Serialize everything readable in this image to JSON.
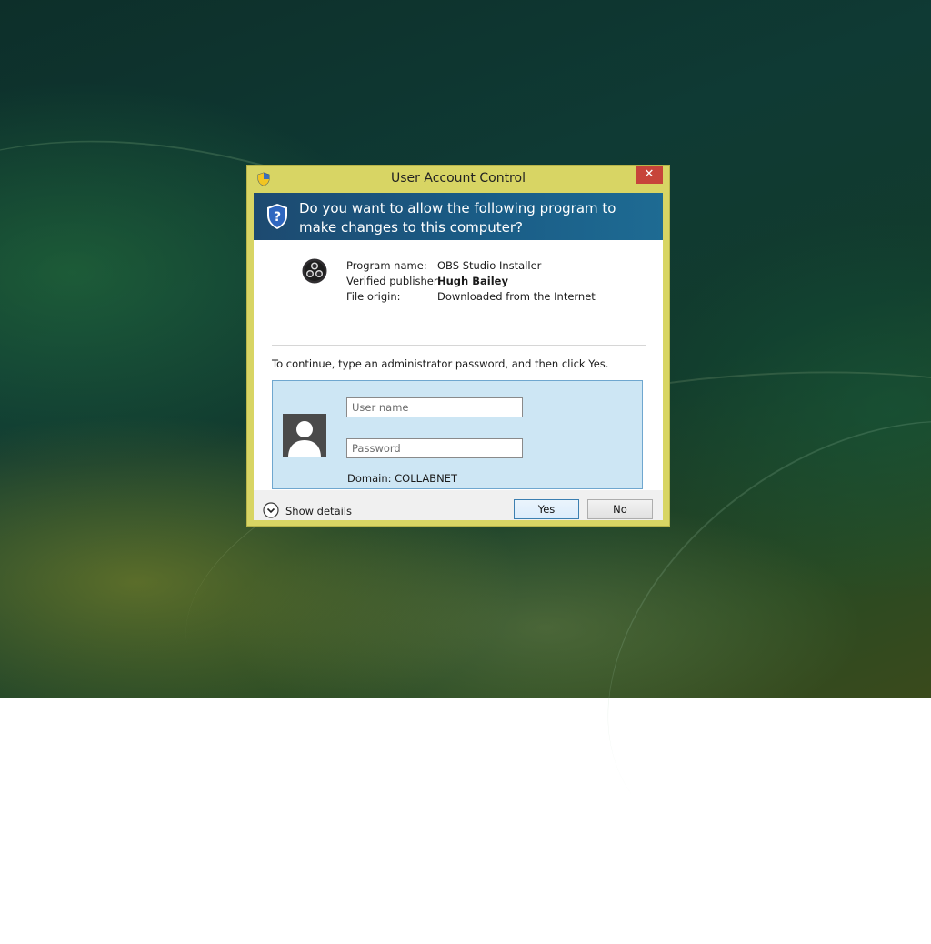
{
  "window": {
    "title": "User Account Control",
    "close_glyph": "✕"
  },
  "banner": {
    "question": "Do you want to allow the following program to make changes to this computer?",
    "icon": "uac-shield-icon"
  },
  "program": {
    "icon": "obs-studio-icon",
    "rows": [
      {
        "label": "Program name:",
        "value": "OBS Studio Installer",
        "bold": false
      },
      {
        "label": "Verified publisher:",
        "value": "Hugh Bailey",
        "bold": true
      },
      {
        "label": "File origin:",
        "value": "Downloaded from the Internet",
        "bold": false
      }
    ]
  },
  "instruction": "To continue, type an administrator password, and then click Yes.",
  "credentials": {
    "username_placeholder": "User name",
    "username_value": "",
    "password_placeholder": "Password",
    "password_value": "",
    "domain": "Domain: COLLABNET",
    "avatar_icon": "user-avatar-icon"
  },
  "footer": {
    "show_details": "Show details",
    "yes": "Yes",
    "no": "No"
  },
  "colors": {
    "frame": "#d8d564",
    "banner": "#1a5c86",
    "panel": "#cde6f4",
    "close": "#c7443a"
  }
}
